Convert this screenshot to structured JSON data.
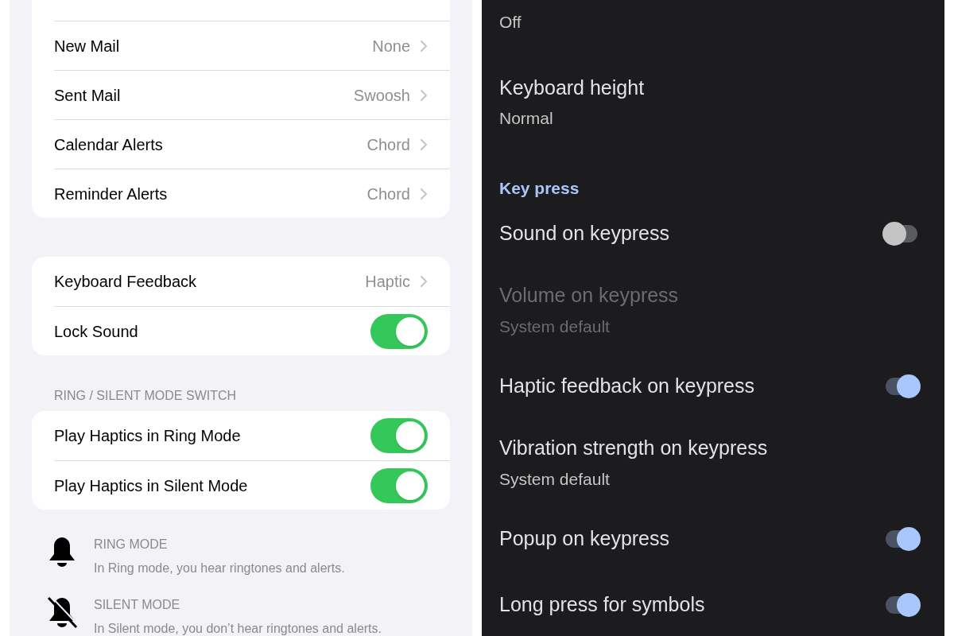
{
  "ios_panel": {
    "groups": [
      {
        "rows": [
          {
            "kind": "value",
            "label": "New Mail",
            "value": "None"
          },
          {
            "kind": "value",
            "label": "Sent Mail",
            "value": "Swoosh"
          },
          {
            "kind": "value",
            "label": "Calendar Alerts",
            "value": "Chord"
          },
          {
            "kind": "value",
            "label": "Reminder Alerts",
            "value": "Chord"
          }
        ]
      },
      {
        "rows": [
          {
            "kind": "value",
            "label": "Keyboard Feedback",
            "value": "Haptic"
          },
          {
            "kind": "toggle",
            "label": "Lock Sound",
            "on": true
          }
        ]
      },
      {
        "header": "RING / SILENT MODE SWITCH",
        "rows": [
          {
            "kind": "toggle",
            "label": "Play Haptics in Ring Mode",
            "on": true
          },
          {
            "kind": "toggle",
            "label": "Play Haptics in Silent Mode",
            "on": true
          }
        ]
      }
    ],
    "modes": [
      {
        "kind": "ring",
        "title": "RING MODE",
        "text": "In Ring mode, you hear ringtones and alerts."
      },
      {
        "kind": "silent",
        "title": "SILENT MODE",
        "text": "In Silent mode, you don’t hear ringtones and alerts."
      }
    ]
  },
  "android_panel": {
    "items": [
      {
        "kind": "setting",
        "subtitle": "Off",
        "disabled": false
      },
      {
        "kind": "setting",
        "title": "Keyboard height",
        "subtitle": "Normal",
        "disabled": false
      },
      {
        "kind": "divider"
      },
      {
        "kind": "header",
        "title": "Key press"
      },
      {
        "kind": "setting",
        "title": "Sound on keypress",
        "toggle": {
          "on": false
        },
        "disabled": false
      },
      {
        "kind": "setting",
        "title": "Volume on keypress",
        "subtitle": "System default",
        "disabled": true
      },
      {
        "kind": "setting",
        "title": "Haptic feedback on keypress",
        "toggle": {
          "on": true
        },
        "disabled": false
      },
      {
        "kind": "setting",
        "title": "Vibration strength on keypress",
        "subtitle": "System default",
        "disabled": false
      },
      {
        "kind": "setting",
        "title": "Popup on keypress",
        "toggle": {
          "on": true
        },
        "disabled": false
      },
      {
        "kind": "setting",
        "title": "Long press for symbols",
        "toggle": {
          "on": true
        },
        "disabled": false
      }
    ]
  }
}
